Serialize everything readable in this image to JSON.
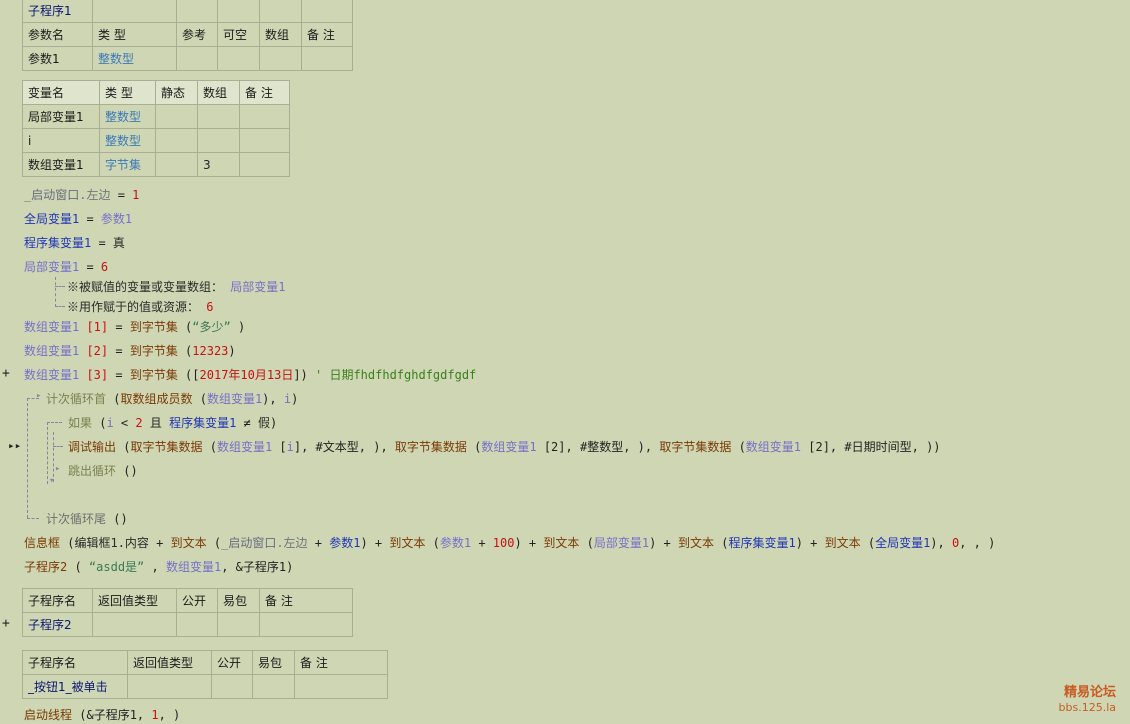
{
  "sub1": {
    "name": "子程序1",
    "param_headers": [
      "参数名",
      "类 型",
      "参考",
      "可空",
      "数组",
      "备 注"
    ],
    "param_rows": [
      [
        "参数1",
        "整数型",
        "",
        "",
        "",
        ""
      ]
    ],
    "var_headers": [
      "变量名",
      "类 型",
      "静态",
      "数组",
      "备 注"
    ],
    "var_rows": [
      [
        "局部变量1",
        "整数型",
        "",
        "",
        ""
      ],
      [
        "i",
        "整数型",
        "",
        "",
        ""
      ],
      [
        "数组变量1",
        "字节集",
        "",
        "3",
        ""
      ]
    ]
  },
  "code": {
    "l1": {
      "a": "_启动窗口",
      "b": ".左边",
      "c": " = ",
      "d": "1"
    },
    "l2": {
      "a": "全局变量1",
      "c": " = ",
      "d": "参数1"
    },
    "l3": {
      "a": "程序集变量1",
      "c": " = ",
      "d": "真"
    },
    "l4": {
      "a": "局部变量1",
      "c": " = ",
      "d": "6"
    },
    "l4a": {
      "a": "※被赋值的变量或变量数组：",
      "b": "局部变量1"
    },
    "l4b": {
      "a": "※用作赋于的值或资源：",
      "b": "6"
    },
    "l5": {
      "a": "数组变量1",
      "b": " [1] ",
      "c": "= ",
      "d": "到字节集",
      "e": " (",
      "f": "“多少”",
      "g": " )"
    },
    "l6": {
      "a": "数组变量1",
      "b": " [2] ",
      "c": "= ",
      "d": "到字节集",
      "e": " (",
      "f": "12323",
      "g": ")"
    },
    "l7": {
      "a": "数组变量1",
      "b": " [3] ",
      "c": "= ",
      "d": "到字节集",
      "e": " ([",
      "f": "2017年10月13日",
      "g": "])",
      "h": " ' 日期fhdfhdfghdfgdfgdf"
    },
    "loop_head": {
      "a": "计次循环首",
      "b": " (",
      "c": "取数组成员数",
      "d": " (",
      "e": "数组变量1",
      "f": "), ",
      "g": "i",
      "h": ")"
    },
    "if_line": {
      "a": "如果",
      "b": " (",
      "c": "i",
      "d": " < ",
      "e": "2",
      "f": " 且 ",
      "g": "程序集变量1",
      "h": " ≠ ",
      "i": "假",
      "j": ")"
    },
    "debug": {
      "a": "调试输出",
      "b": " (",
      "c": "取字节集数据",
      "d": " (",
      "e": "数组变量1",
      "f": " [",
      "g": "i",
      "h": "], ",
      "i": "#文本型",
      "j": ", ), ",
      "k": "取字节集数据",
      "l": " (",
      "m": "数组变量1",
      "n": " [2], ",
      "o": "#整数型",
      "p": ", ), ",
      "q": "取字节集数据",
      "r": " (",
      "s": "数组变量1",
      "t": " [2], ",
      "u": "#日期时间型",
      "v": ", ))"
    },
    "break_line": {
      "a": "跳出循环",
      "b": " ()"
    },
    "loop_tail": {
      "a": "计次循环尾",
      "b": " ()"
    },
    "msgbox": {
      "a": "信息框",
      "b": " (",
      "c": "编辑框1",
      "d": ".内容",
      "e": " + ",
      "f": "到文本",
      "g": " (",
      "h": "_启动窗口",
      "i": ".左边",
      "j": " + ",
      "k": "参数1",
      "l": ") + ",
      "m": "到文本",
      "n": " (",
      "o": "参数1",
      "p": " + ",
      "q": "100",
      "r": ") + ",
      "s": "到文本",
      "t": " (",
      "u": "局部变量1",
      "v": ") + ",
      "w": "到文本",
      "x": " (",
      "y": "程序集变量1",
      "z": ") + ",
      "aa": "到文本",
      "ab": " (",
      "ac": "全局变量1",
      "ad": "), ",
      "ae": "0",
      "af": ", , )"
    },
    "call2": {
      "a": "子程序2",
      "b": " ( ",
      "c": "“asdd是”",
      "d": " , ",
      "e": "数组变量1",
      "f": ", &子程序1)"
    }
  },
  "sub2": {
    "headers": [
      "子程序名",
      "返回值类型",
      "公开",
      "易包",
      "备 注"
    ],
    "row": [
      "子程序2",
      "",
      "",
      "",
      ""
    ]
  },
  "sub3": {
    "headers": [
      "子程序名",
      "返回值类型",
      "公开",
      "易包",
      "备 注"
    ],
    "row": [
      "_按钮1_被单击",
      "",
      "",
      "",
      ""
    ],
    "code": {
      "a": "启动线程",
      "b": " (&子程序1, ",
      "c": "1",
      "d": ", )"
    }
  },
  "markers": {
    "plus": "+",
    "arrow": "⇥"
  },
  "watermark": {
    "line1": "精易论坛",
    "line2": "bbs.125.la"
  }
}
